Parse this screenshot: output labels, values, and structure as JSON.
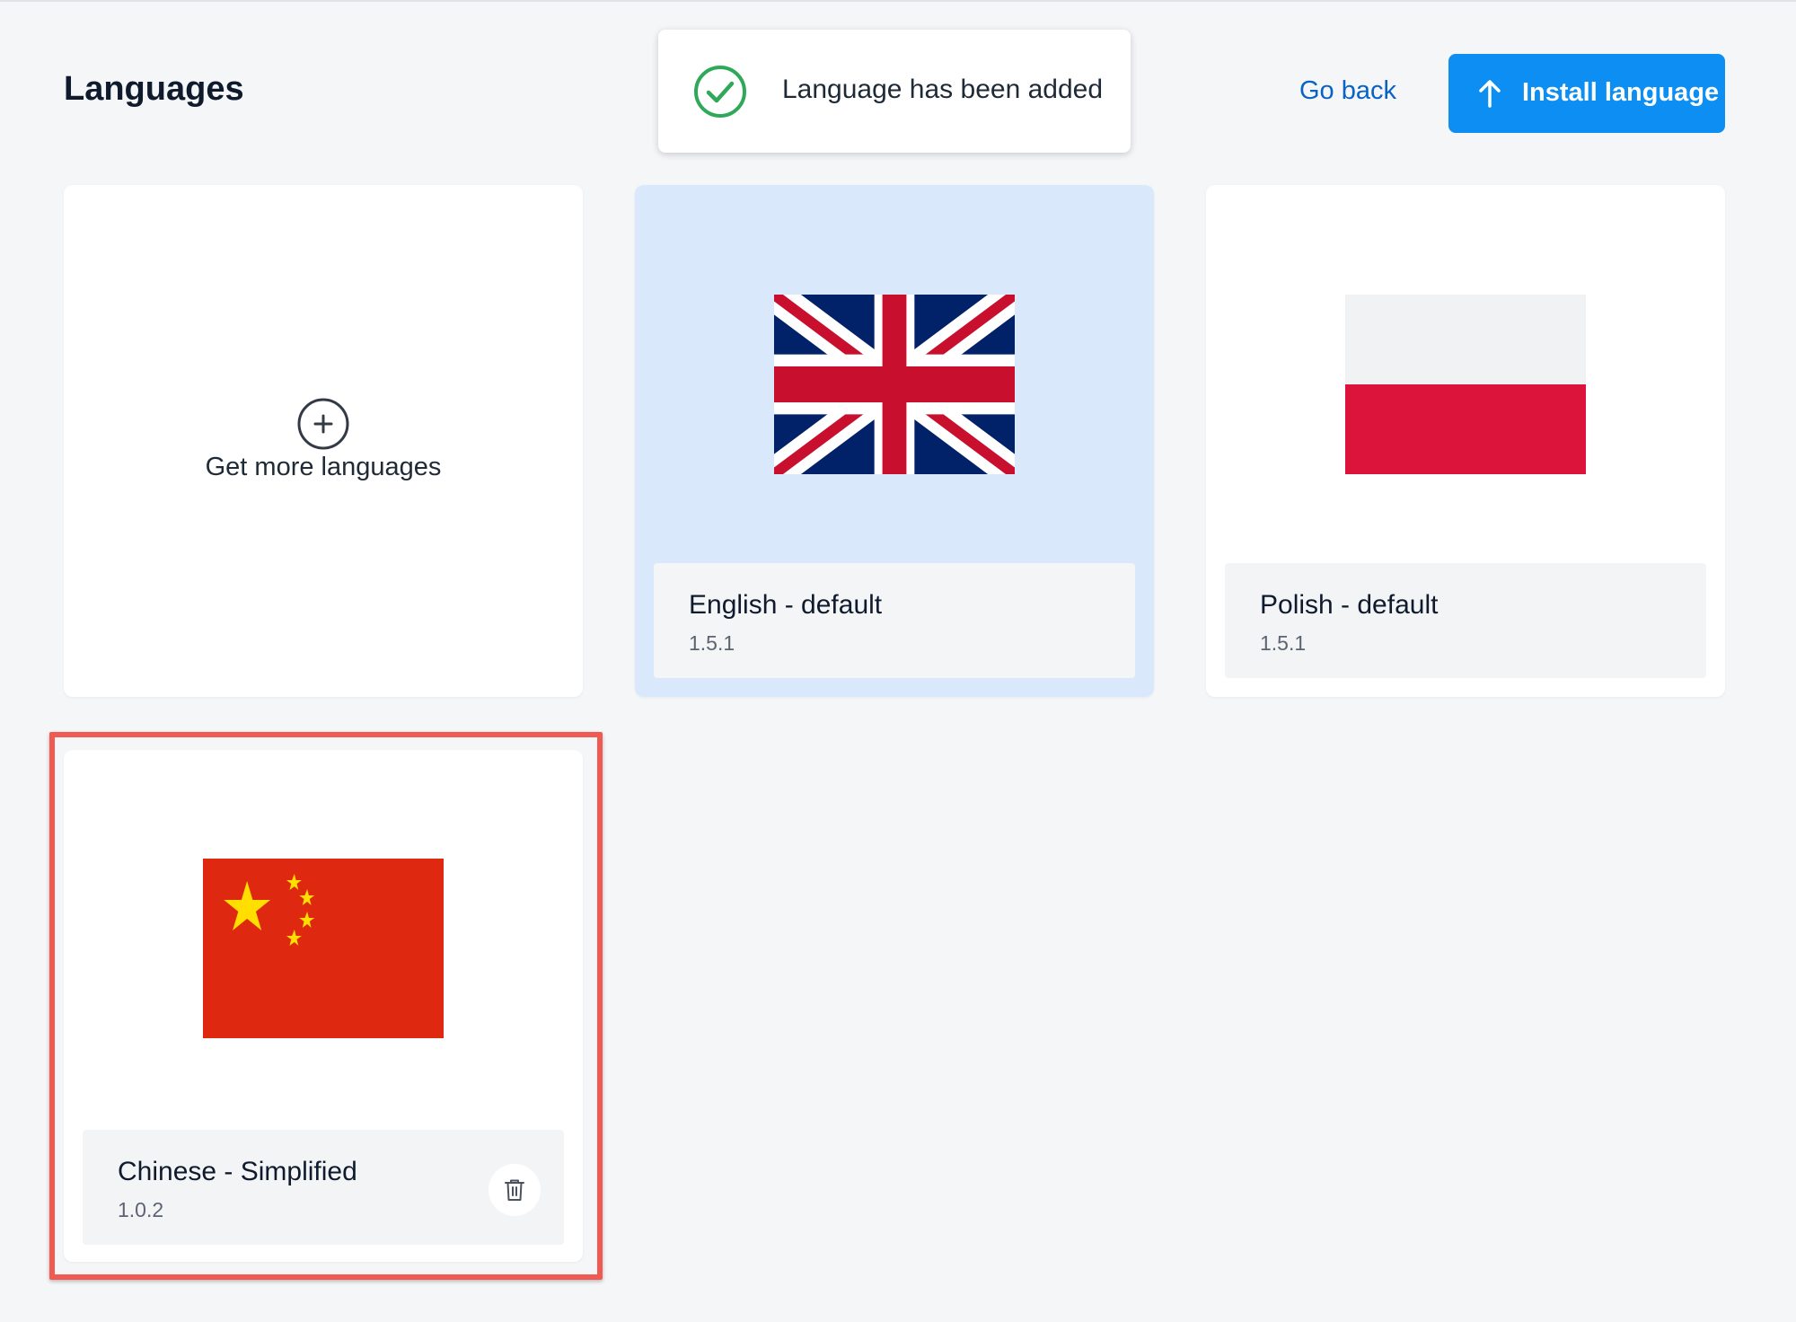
{
  "header": {
    "title": "Languages",
    "go_back_label": "Go back",
    "install_label": "Install language"
  },
  "toast": {
    "message": "Language has been added",
    "icon": "check-circle-icon",
    "color": "#2fa85a"
  },
  "colors": {
    "accent": "#0d8ef2",
    "link": "#0a62c4",
    "highlight": "#f05a50",
    "selected_card": "#d9e9fb"
  },
  "get_more": {
    "label": "Get more languages",
    "icon": "plus-circle-icon"
  },
  "languages": [
    {
      "name": "English - default",
      "version": "1.5.1",
      "flag": "uk-flag",
      "selected": true,
      "deletable": false
    },
    {
      "name": "Polish - default",
      "version": "1.5.1",
      "flag": "poland-flag",
      "selected": false,
      "deletable": false
    },
    {
      "name": "Chinese - Simplified",
      "version": "1.0.2",
      "flag": "china-flag",
      "selected": false,
      "deletable": true,
      "highlighted": true
    }
  ]
}
